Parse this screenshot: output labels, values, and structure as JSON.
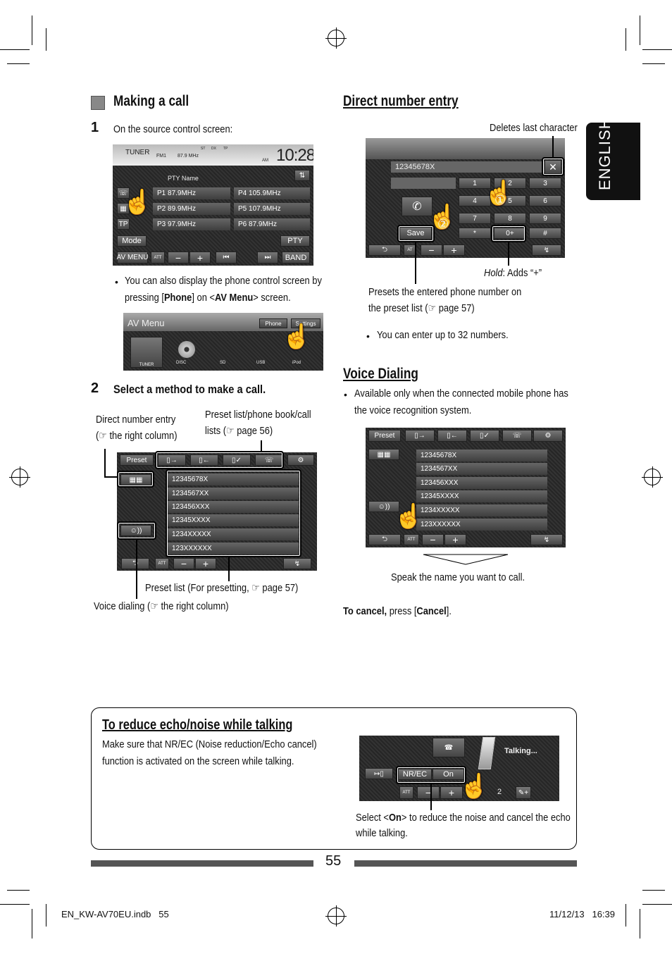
{
  "side_tab": "ENGLISH",
  "left": {
    "title": "Making a call",
    "step1_num": "1",
    "step1_text": "On the source control screen:",
    "tuner": {
      "source": "TUNER",
      "band": "FM1",
      "preset": "P1",
      "freq": "87.9 MHz",
      "indicators": [
        "ST",
        "DX",
        "TP"
      ],
      "ampm": "AM",
      "clock": "10:28",
      "pty_name": "PTY Name",
      "presets": [
        {
          "p": "P1",
          "f": "87.9MHz"
        },
        {
          "p": "P4",
          "f": "105.9MHz"
        },
        {
          "p": "P2",
          "f": "89.9MHz"
        },
        {
          "p": "P5",
          "f": "107.9MHz"
        },
        {
          "p": "P3",
          "f": "97.9MHz"
        },
        {
          "p": "P6",
          "f": "87.9MHz"
        }
      ],
      "tp": "TP",
      "mode": "Mode",
      "pty": "PTY",
      "av_menu": "AV MENU",
      "att": "ATT",
      "band_btn": "BAND"
    },
    "bullet1_a": "You can also display the phone control screen by",
    "bullet1_b_pre": "pressing [",
    "bullet1_b_phone": "Phone",
    "bullet1_b_mid": "] on <",
    "bullet1_b_av": "AV Menu",
    "bullet1_b_post": "> screen.",
    "avmenu": {
      "title": "AV Menu",
      "phone": "Phone",
      "settings": "Settings",
      "items": [
        "TUNER",
        "DISC",
        "SD",
        "USB",
        "iPod"
      ]
    },
    "step2_num": "2",
    "step2_text": "Select a method to make a call.",
    "ann_direct_a": "Direct number entry",
    "ann_direct_b": "(☞ the right column)",
    "ann_preset_a": "Preset list/phone book/call",
    "ann_preset_b": "lists (☞ page 56)",
    "ann_presetlist": "Preset list (For presetting, ☞ page 57)",
    "ann_voice": "Voice dialing (☞ the right column)",
    "phone_list": {
      "preset_tab": "Preset",
      "numbers": [
        "12345678X",
        "1234567XX",
        "123456XXX",
        "12345XXXX",
        "1234XXXXX",
        "123XXXXXX"
      ],
      "att": "ATT"
    }
  },
  "right": {
    "direct_title": "Direct number entry",
    "deletes": "Deletes last character",
    "keypad": {
      "number": "12345678X",
      "keys": [
        "1",
        "2",
        "3",
        "4",
        "5",
        "6",
        "7",
        "8",
        "9",
        "*",
        "0+",
        "#"
      ],
      "save": "Save",
      "att": "AT",
      "circle1": "①",
      "circle2": "②"
    },
    "hold_label": "Hold",
    "hold_text": ": Adds “+”",
    "presets_a": "Presets the entered phone number on",
    "presets_b": "the preset list (☞ page 57)",
    "bullet_32": "You can enter up to 32 numbers.",
    "voice_title": "Voice Dialing",
    "voice_bullet_a": "Available only when the connected mobile phone has",
    "voice_bullet_b": "the voice recognition system.",
    "speak": "Speak the name you want to call.",
    "cancel_bold": "To cancel,",
    "cancel_mid": " press [",
    "cancel_btn": "Cancel",
    "cancel_end": "]."
  },
  "box": {
    "title": "To reduce echo/noise while talking",
    "text_a": "Make sure that NR/EC (Noise reduction/Echo cancel)",
    "text_b": "function is activated on the screen while talking.",
    "talking": "Talking...",
    "nrec": "NR/EC",
    "on": "On",
    "att": "ATT",
    "vol": "2",
    "select_pre": "Select <",
    "select_on": "On",
    "select_post": "> to reduce the noise and cancel the echo",
    "select_b": "while talking."
  },
  "page_number": "55",
  "footer": {
    "file": "EN_KW-AV70EU.indb   55",
    "date": "11/12/13   16:39"
  }
}
